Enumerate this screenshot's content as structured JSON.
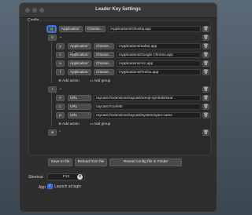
{
  "window": {
    "title": "Leader Key Settings"
  },
  "labels": {
    "config": "Config",
    "shortcut": "Shortcut",
    "app": "App"
  },
  "choose_label": "Choose...",
  "add_action_label": "Add action",
  "add_group_label": "Add group",
  "top_rows": [
    {
      "key": "g",
      "type": "Application",
      "value": "/Applications/Ghostty.app"
    }
  ],
  "groups": [
    {
      "key": "b",
      "expanded": true,
      "items": [
        {
          "key": "y",
          "type": "Application",
          "value": "/Applications/Safari.app"
        },
        {
          "key": "c",
          "type": "Application",
          "value": "/Applications/Google Chrome.app"
        },
        {
          "key": "a",
          "type": "Application",
          "value": "/Applications/Arc.app"
        },
        {
          "key": "f",
          "type": "Application",
          "value": "/Applications/Firefox.app"
        }
      ]
    },
    {
      "key": "r",
      "expanded": true,
      "items": [
        {
          "key": "e",
          "type": "URL",
          "value": "raycast://extensions/raycast/emoji-symbols/sear"
        },
        {
          "key": "c",
          "type": "URL",
          "value": "raycast://confetti"
        },
        {
          "key": "p",
          "type": "URL",
          "value": "raycast://extensions/raycast/system/open-came"
        }
      ]
    },
    {
      "key": "w",
      "expanded": false,
      "items": []
    }
  ],
  "footer_buttons": {
    "save": "Save to file",
    "reload": "Reload from file",
    "reveal": "Reveal config file in Finder"
  },
  "shortcut": {
    "value": "F12"
  },
  "app_options": {
    "launch_at_login_label": "Launch at login",
    "launch_at_login_checked": true
  }
}
